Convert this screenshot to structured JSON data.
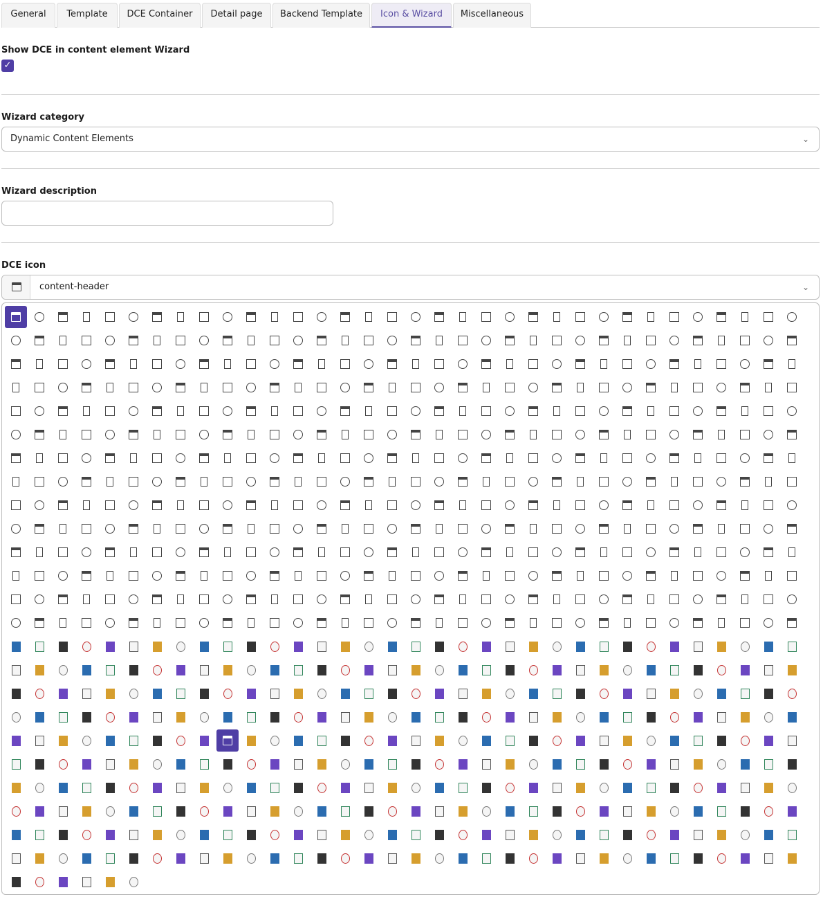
{
  "tabs": [
    "General",
    "Template",
    "DCE Container",
    "Detail page",
    "Backend Template",
    "Icon & Wizard",
    "Miscellaneous"
  ],
  "active_tab": "Icon & Wizard",
  "wizard_checkbox": {
    "label": "Show DCE in content element Wizard",
    "checked": true
  },
  "wizard_category": {
    "label": "Wizard category",
    "value": "Dynamic Content Elements"
  },
  "wizard_description": {
    "label": "Wizard description",
    "value": ""
  },
  "dce_icon": {
    "label": "DCE icon",
    "value": "content-header"
  },
  "icon_grid": {
    "rows": 25,
    "columns": 34,
    "last_row_count": 6,
    "selected_index": 0,
    "second_selected_index": 621
  },
  "colors": {
    "accent": "#4f3ea5",
    "border": "#bdbdbd"
  }
}
